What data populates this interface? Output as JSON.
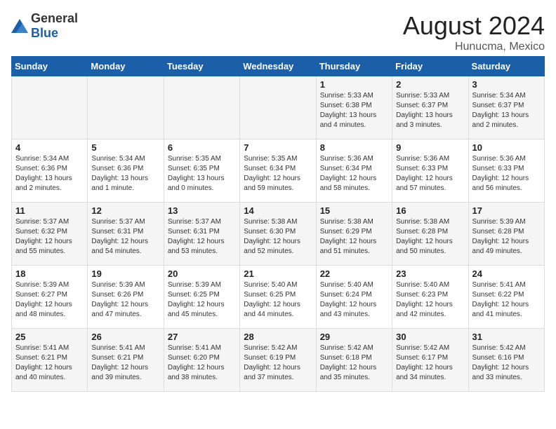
{
  "header": {
    "logo_general": "General",
    "logo_blue": "Blue",
    "month_year": "August 2024",
    "location": "Hunucma, Mexico"
  },
  "days_of_week": [
    "Sunday",
    "Monday",
    "Tuesday",
    "Wednesday",
    "Thursday",
    "Friday",
    "Saturday"
  ],
  "weeks": [
    [
      {
        "day": "",
        "info": ""
      },
      {
        "day": "",
        "info": ""
      },
      {
        "day": "",
        "info": ""
      },
      {
        "day": "",
        "info": ""
      },
      {
        "day": "1",
        "info": "Sunrise: 5:33 AM\nSunset: 6:38 PM\nDaylight: 13 hours\nand 4 minutes."
      },
      {
        "day": "2",
        "info": "Sunrise: 5:33 AM\nSunset: 6:37 PM\nDaylight: 13 hours\nand 3 minutes."
      },
      {
        "day": "3",
        "info": "Sunrise: 5:34 AM\nSunset: 6:37 PM\nDaylight: 13 hours\nand 2 minutes."
      }
    ],
    [
      {
        "day": "4",
        "info": "Sunrise: 5:34 AM\nSunset: 6:36 PM\nDaylight: 13 hours\nand 2 minutes."
      },
      {
        "day": "5",
        "info": "Sunrise: 5:34 AM\nSunset: 6:36 PM\nDaylight: 13 hours\nand 1 minute."
      },
      {
        "day": "6",
        "info": "Sunrise: 5:35 AM\nSunset: 6:35 PM\nDaylight: 13 hours\nand 0 minutes."
      },
      {
        "day": "7",
        "info": "Sunrise: 5:35 AM\nSunset: 6:34 PM\nDaylight: 12 hours\nand 59 minutes."
      },
      {
        "day": "8",
        "info": "Sunrise: 5:36 AM\nSunset: 6:34 PM\nDaylight: 12 hours\nand 58 minutes."
      },
      {
        "day": "9",
        "info": "Sunrise: 5:36 AM\nSunset: 6:33 PM\nDaylight: 12 hours\nand 57 minutes."
      },
      {
        "day": "10",
        "info": "Sunrise: 5:36 AM\nSunset: 6:33 PM\nDaylight: 12 hours\nand 56 minutes."
      }
    ],
    [
      {
        "day": "11",
        "info": "Sunrise: 5:37 AM\nSunset: 6:32 PM\nDaylight: 12 hours\nand 55 minutes."
      },
      {
        "day": "12",
        "info": "Sunrise: 5:37 AM\nSunset: 6:31 PM\nDaylight: 12 hours\nand 54 minutes."
      },
      {
        "day": "13",
        "info": "Sunrise: 5:37 AM\nSunset: 6:31 PM\nDaylight: 12 hours\nand 53 minutes."
      },
      {
        "day": "14",
        "info": "Sunrise: 5:38 AM\nSunset: 6:30 PM\nDaylight: 12 hours\nand 52 minutes."
      },
      {
        "day": "15",
        "info": "Sunrise: 5:38 AM\nSunset: 6:29 PM\nDaylight: 12 hours\nand 51 minutes."
      },
      {
        "day": "16",
        "info": "Sunrise: 5:38 AM\nSunset: 6:28 PM\nDaylight: 12 hours\nand 50 minutes."
      },
      {
        "day": "17",
        "info": "Sunrise: 5:39 AM\nSunset: 6:28 PM\nDaylight: 12 hours\nand 49 minutes."
      }
    ],
    [
      {
        "day": "18",
        "info": "Sunrise: 5:39 AM\nSunset: 6:27 PM\nDaylight: 12 hours\nand 48 minutes."
      },
      {
        "day": "19",
        "info": "Sunrise: 5:39 AM\nSunset: 6:26 PM\nDaylight: 12 hours\nand 47 minutes."
      },
      {
        "day": "20",
        "info": "Sunrise: 5:39 AM\nSunset: 6:25 PM\nDaylight: 12 hours\nand 45 minutes."
      },
      {
        "day": "21",
        "info": "Sunrise: 5:40 AM\nSunset: 6:25 PM\nDaylight: 12 hours\nand 44 minutes."
      },
      {
        "day": "22",
        "info": "Sunrise: 5:40 AM\nSunset: 6:24 PM\nDaylight: 12 hours\nand 43 minutes."
      },
      {
        "day": "23",
        "info": "Sunrise: 5:40 AM\nSunset: 6:23 PM\nDaylight: 12 hours\nand 42 minutes."
      },
      {
        "day": "24",
        "info": "Sunrise: 5:41 AM\nSunset: 6:22 PM\nDaylight: 12 hours\nand 41 minutes."
      }
    ],
    [
      {
        "day": "25",
        "info": "Sunrise: 5:41 AM\nSunset: 6:21 PM\nDaylight: 12 hours\nand 40 minutes."
      },
      {
        "day": "26",
        "info": "Sunrise: 5:41 AM\nSunset: 6:21 PM\nDaylight: 12 hours\nand 39 minutes."
      },
      {
        "day": "27",
        "info": "Sunrise: 5:41 AM\nSunset: 6:20 PM\nDaylight: 12 hours\nand 38 minutes."
      },
      {
        "day": "28",
        "info": "Sunrise: 5:42 AM\nSunset: 6:19 PM\nDaylight: 12 hours\nand 37 minutes."
      },
      {
        "day": "29",
        "info": "Sunrise: 5:42 AM\nSunset: 6:18 PM\nDaylight: 12 hours\nand 35 minutes."
      },
      {
        "day": "30",
        "info": "Sunrise: 5:42 AM\nSunset: 6:17 PM\nDaylight: 12 hours\nand 34 minutes."
      },
      {
        "day": "31",
        "info": "Sunrise: 5:42 AM\nSunset: 6:16 PM\nDaylight: 12 hours\nand 33 minutes."
      }
    ]
  ]
}
